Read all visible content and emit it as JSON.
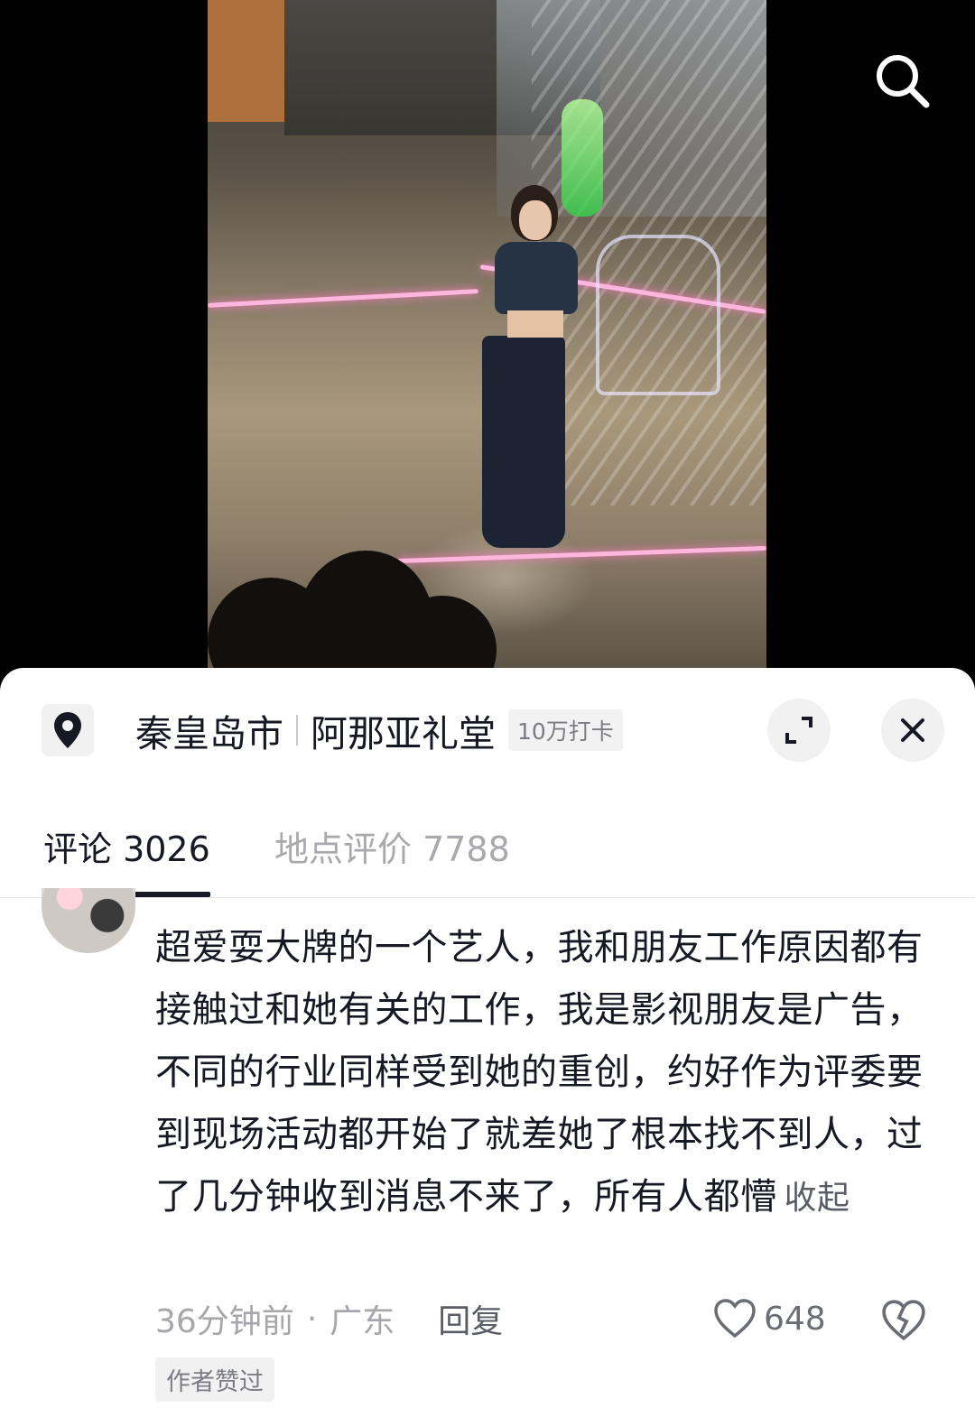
{
  "location": {
    "city": "秦皇岛市",
    "venue": "阿那亚礼堂",
    "checkins": "10万打卡"
  },
  "icons": {
    "search": "search-icon",
    "pin": "location-pin-icon",
    "expand": "expand-icon",
    "close": "close-icon",
    "like": "heart-icon",
    "dislike": "broken-heart-icon"
  },
  "tabs": [
    {
      "label": "评论 3026",
      "active": true
    },
    {
      "label": "地点评价 7788",
      "active": false
    }
  ],
  "comment": {
    "text": "超爱耍大牌的一个艺人，我和朋友工作原因都有接触过和她有关的工作，我是影视朋友是广告，不同的行业同样受到她的重创，约好作为评委要到现场活动都开始了就差她了根本找不到人，过了几分钟收到消息不来了，所有人都懵",
    "collapse_label": "收起",
    "time": "36分钟前",
    "separator": "·",
    "region": "广东",
    "reply_label": "回复",
    "likes": "648",
    "author_badge": "作者赞过"
  },
  "colors": {
    "text_primary": "#161823",
    "text_secondary": "#a6a7ab",
    "sheet_bg": "#ffffff",
    "video_bg": "#000000"
  }
}
